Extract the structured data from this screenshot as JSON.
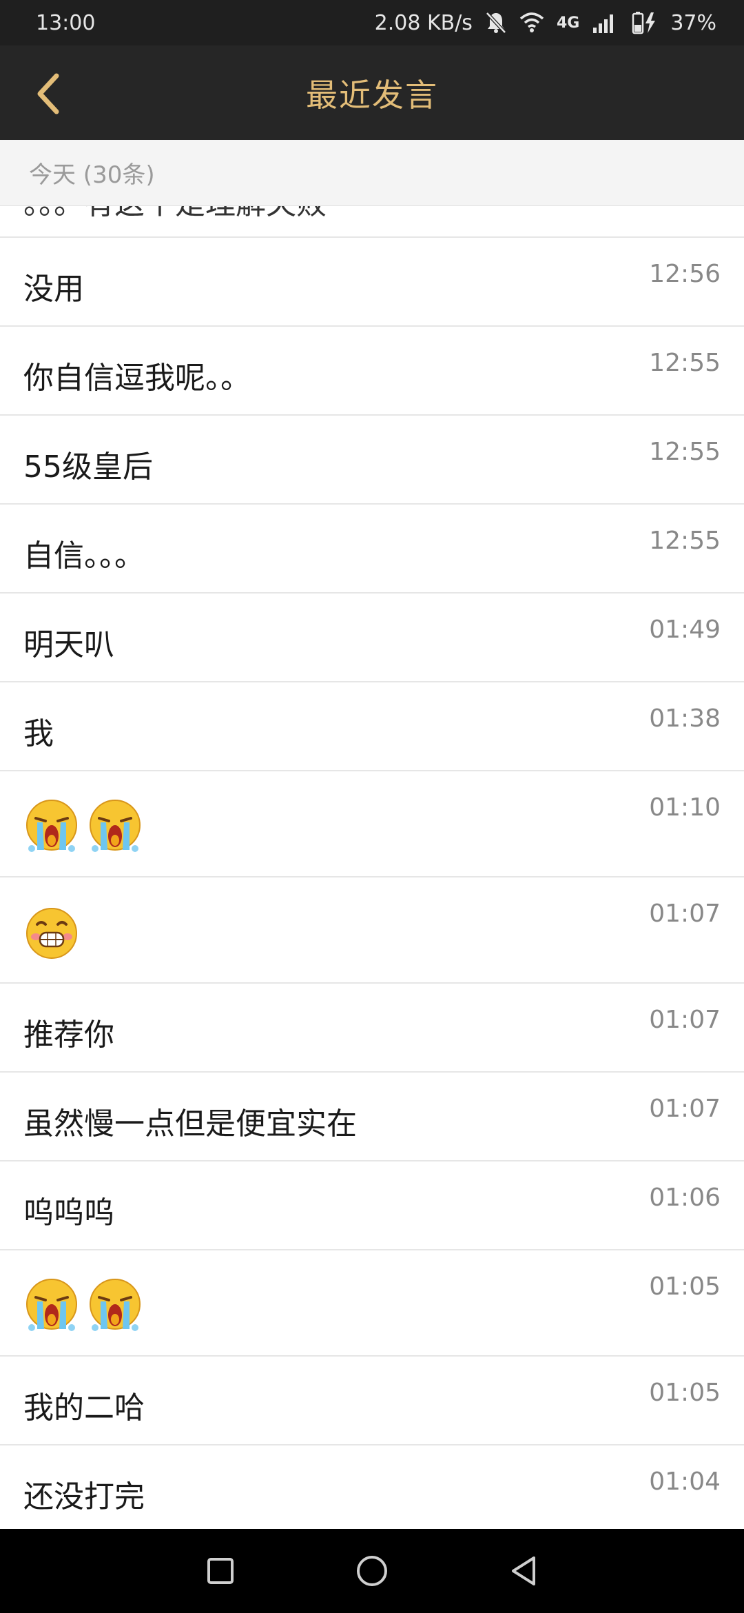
{
  "status_bar": {
    "time": "13:00",
    "speed": "2.08 KB/s",
    "network": "4G",
    "battery": "37%",
    "icons": [
      "mute-bell-icon",
      "wifi-icon",
      "signal-icon",
      "battery-charging-icon"
    ]
  },
  "header": {
    "title": "最近发言",
    "back_icon": "chevron-left-icon"
  },
  "section": {
    "label": "今天 (30条)"
  },
  "messages": [
    {
      "text": "。。。有这个是理解失败",
      "time": ""
    },
    {
      "text": "没用",
      "time": "12:56"
    },
    {
      "text": "你自信逗我呢。。",
      "time": "12:55"
    },
    {
      "text": "55级皇后",
      "time": "12:55"
    },
    {
      "text": "自信。。。",
      "time": "12:55"
    },
    {
      "text": "明天叭",
      "time": "01:49"
    },
    {
      "text": "我",
      "time": "01:38"
    },
    {
      "emoji": [
        "crying-face-icon",
        "crying-face-icon"
      ],
      "time": "01:10"
    },
    {
      "emoji": [
        "grinning-face-icon"
      ],
      "time": "01:07"
    },
    {
      "text": "推荐你",
      "time": "01:07"
    },
    {
      "text": "虽然慢一点但是便宜实在",
      "time": "01:07"
    },
    {
      "text": "呜呜呜",
      "time": "01:06"
    },
    {
      "emoji": [
        "crying-face-icon",
        "crying-face-icon"
      ],
      "time": "01:05"
    },
    {
      "text": "我的二哈",
      "time": "01:05"
    },
    {
      "text": "还没打完",
      "time": "01:04"
    }
  ],
  "nav": {
    "icons": [
      "recents-square-icon",
      "home-circle-icon",
      "back-triangle-icon"
    ]
  },
  "colors": {
    "title_gold": "#e3bd78",
    "header_bg": "#262626",
    "status_bg": "#1f1f1f"
  }
}
